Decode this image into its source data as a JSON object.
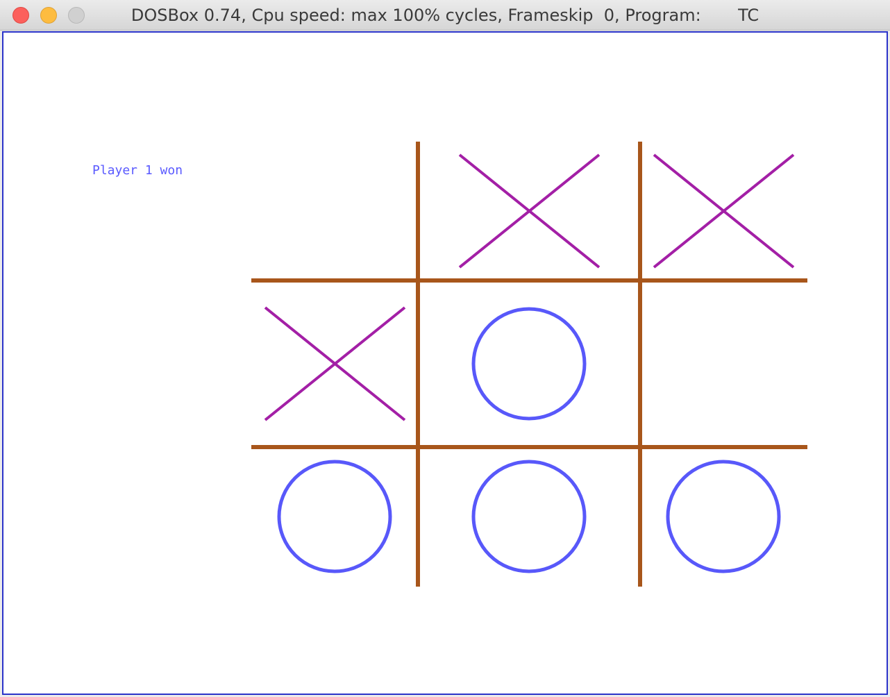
{
  "window": {
    "title": "DOSBox 0.74, Cpu speed: max 100% cycles, Frameskip  0, Program:       TC"
  },
  "game": {
    "status_message": "Player 1 won",
    "board": [
      [
        "",
        "X",
        "X"
      ],
      [
        "X",
        "O",
        ""
      ],
      [
        "O",
        "O",
        "O"
      ]
    ]
  },
  "colors": {
    "grid": "#a8561b",
    "x_mark": "#a31fa6",
    "o_mark": "#5858fa",
    "status_text": "#5a5aff",
    "window_border": "#2b33c9"
  }
}
